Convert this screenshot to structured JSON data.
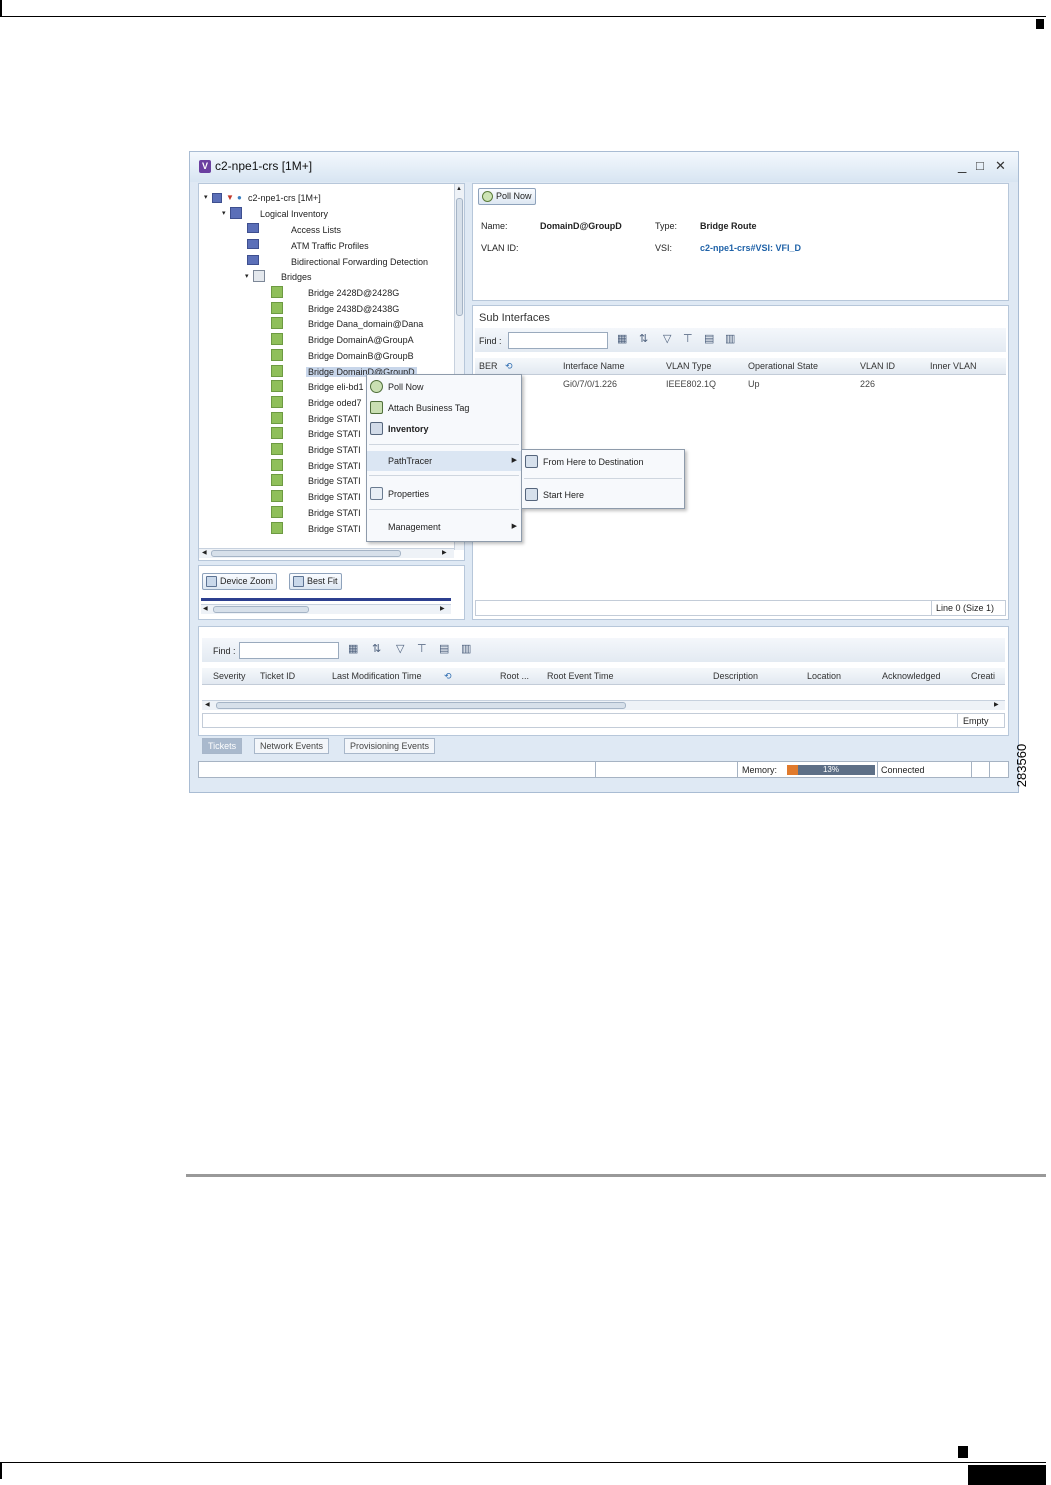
{
  "figure_number": "283560",
  "window": {
    "title": "c2-npe1-crs [1M+]",
    "app_icon_letter": "V",
    "controls": {
      "minimize": "_",
      "maximize": "□",
      "close": "✕"
    }
  },
  "tree": {
    "root": "c2-npe1-crs [1M+]",
    "logical_inventory": "Logical Inventory",
    "items": [
      "Access Lists",
      "ATM Traffic Profiles",
      "Bidirectional Forwarding Detection"
    ],
    "bridges_label": "Bridges",
    "bridges": [
      "Bridge 2428D@2428G",
      "Bridge 2438D@2438G",
      "Bridge Dana_domain@Dana",
      "Bridge DomainA@GroupA",
      "Bridge DomainB@GroupB",
      "Bridge DomainD@GroupD",
      "Bridge eli-bd1",
      "Bridge oded7",
      "Bridge STATI",
      "Bridge STATI",
      "Bridge STATI",
      "Bridge STATI",
      "Bridge STATI",
      "Bridge STATI",
      "Bridge STATI",
      "Bridge STATI"
    ]
  },
  "zoom_buttons": {
    "device_zoom": "Device Zoom",
    "best_fit": "Best Fit"
  },
  "details": {
    "poll_now": "Poll Now",
    "name_label": "Name:",
    "name_value": "DomainD@GroupD",
    "type_label": "Type:",
    "type_value": "Bridge Route",
    "vlan_label": "VLAN ID:",
    "vsi_label": "VSI:",
    "vsi_value": "c2-npe1-crs#VSI: VFI_D"
  },
  "sub_interfaces": {
    "title": "Sub Interfaces",
    "find_label": "Find :",
    "columns": [
      "BER",
      "Interface Name",
      "VLAN Type",
      "Operational State",
      "VLAN ID",
      "Inner VLAN"
    ],
    "rows": [
      {
        "interface": "Gi0/7/0/1.226",
        "vlan_type": "IEEE802.1Q",
        "state": "Up",
        "vlan_id": "226"
      }
    ],
    "status": "Line 0 (Size 1)"
  },
  "context_menu": {
    "items": [
      "Poll Now",
      "Attach Business Tag",
      "Inventory",
      "PathTracer",
      "Properties",
      "Management"
    ]
  },
  "submenu": {
    "items": [
      "From Here to Destination",
      "Start Here"
    ]
  },
  "tickets": {
    "find_label": "Find :",
    "columns": [
      "Severity",
      "Ticket ID",
      "Last Modification Time",
      "Root ...",
      "Root Event Time",
      "Description",
      "Location",
      "Acknowledged",
      "Creati"
    ],
    "empty_label": "Empty",
    "tabs": [
      "Tickets",
      "Network Events",
      "Provisioning Events"
    ]
  },
  "statusbar": {
    "memory_label": "Memory:",
    "memory_percent": 13,
    "memory_text": "13%",
    "connection": "Connected"
  }
}
